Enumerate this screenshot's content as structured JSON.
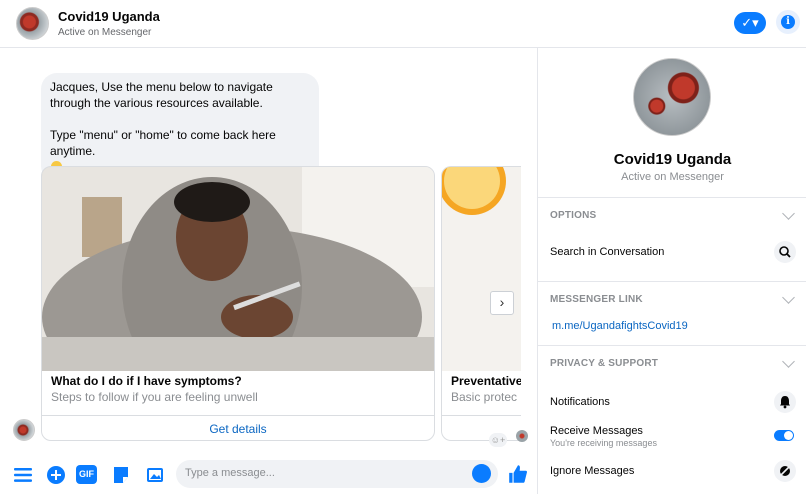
{
  "header": {
    "name": "Covid19 Uganda",
    "status": "Active on Messenger",
    "check_icon": "check-dropdown-icon",
    "info_icon": "info-icon"
  },
  "chat": {
    "message": "Jacques, Use the menu below to navigate through the various resources available.\n\nType \"menu\" or \"home\" to come back here anytime.",
    "cards": [
      {
        "title": "What do I do if I have symptoms?",
        "subtitle": "Steps to follow if you are feeling unwell",
        "button": "Get details"
      },
      {
        "title": "Preventative",
        "subtitle": "Basic protec",
        "button": ""
      }
    ],
    "next_icon": "›"
  },
  "composer": {
    "placeholder": "Type a message...",
    "icons": [
      "menu-icon",
      "plus-icon",
      "gif-icon",
      "sticker-icon",
      "image-icon",
      "emoji-icon",
      "thumbs-up-icon"
    ],
    "gif_label": "GIF"
  },
  "panel": {
    "name": "Covid19 Uganda",
    "status": "Active on Messenger",
    "options_head": "OPTIONS",
    "search_label": "Search in Conversation",
    "messenger_link_head": "MESSENGER LINK",
    "messenger_link": "m.me/UgandafightsCovid19",
    "privacy_head": "PRIVACY & SUPPORT",
    "notifications_label": "Notifications",
    "receive_label": "Receive Messages",
    "receive_sub": "You're receiving messages",
    "receive_on": true,
    "ignore_label": "Ignore Messages"
  },
  "colors": {
    "accent": "#0a7cff",
    "link": "#0a66c2"
  }
}
